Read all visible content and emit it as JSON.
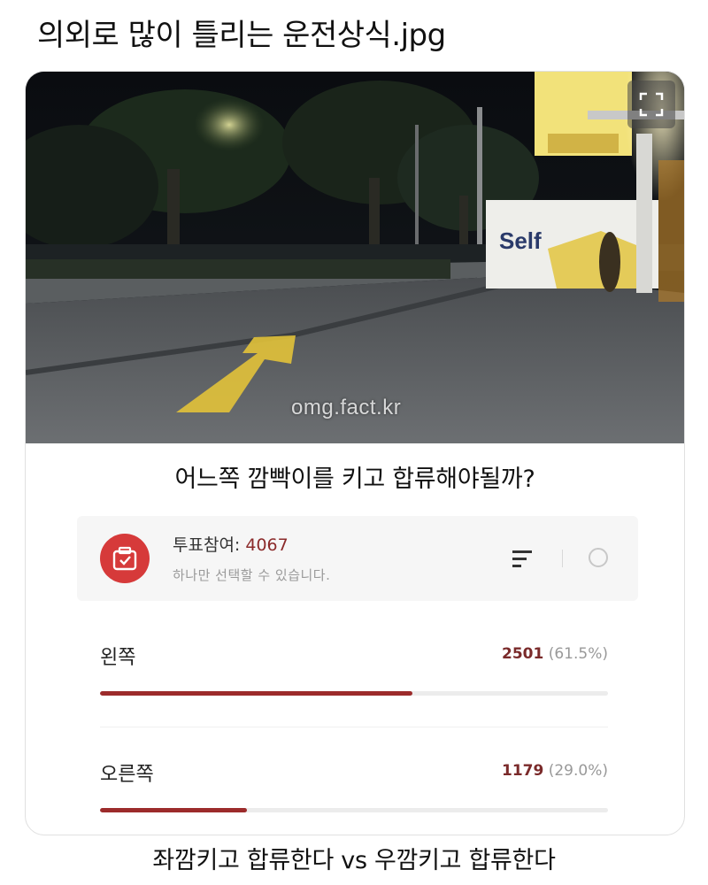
{
  "post": {
    "title": "의외로 많이 틀리는 운전상식.jpg",
    "caption": "좌깜키고 합류한다 vs 우깜키고 합류한다"
  },
  "media": {
    "sign_text": "Self",
    "watermark": "omg.fact.kr",
    "expand_icon": "expand-icon"
  },
  "poll": {
    "question": "어느쪽 깜빡이를 키고 합류해야될까?",
    "participation_label": "투표참여: ",
    "participation_count": "4067",
    "instruction": "하나만 선택할 수 있습니다.",
    "icon": "ballot-box-icon",
    "accent_color": "#d63a3a",
    "bar_color": "#9c2b2b",
    "options": [
      {
        "label": "왼쪽",
        "votes": "2501",
        "percent_text": "(61.5%)",
        "fraction": 0.615
      },
      {
        "label": "오른쪽",
        "votes": "1179",
        "percent_text": "(29.0%)",
        "fraction": 0.29
      }
    ]
  }
}
